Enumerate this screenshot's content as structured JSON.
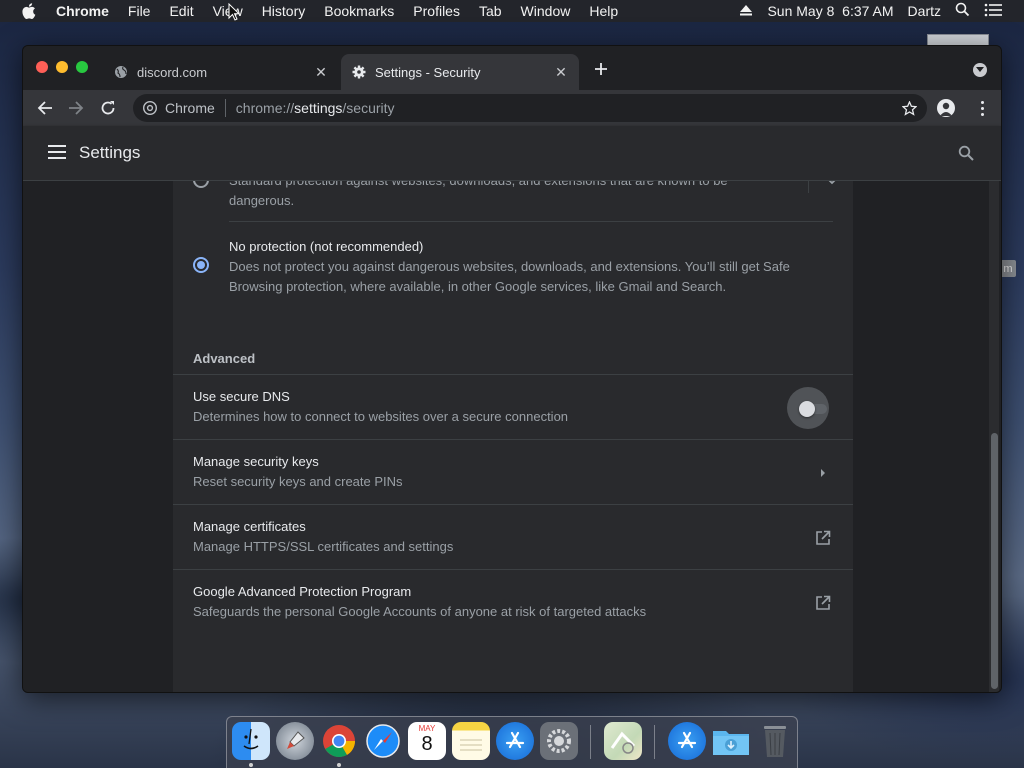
{
  "menubar": {
    "app": "Chrome",
    "items": [
      "File",
      "Edit",
      "View",
      "History",
      "Bookmarks",
      "Profiles",
      "Tab",
      "Window",
      "Help"
    ],
    "datetime": "Sun May 8  6:37 AM",
    "user": "Dartz"
  },
  "tabs": [
    {
      "title": "discord.com",
      "icon": "globe-icon"
    },
    {
      "title": "Settings - Security",
      "icon": "gear-icon"
    }
  ],
  "omnibox": {
    "chip": "Chrome",
    "url_prefix": "chrome://",
    "url_host": "settings",
    "url_path": "/security"
  },
  "settings": {
    "title": "Settings",
    "standard_protection_desc": "Standard protection against websites, downloads, and extensions that are known to be dangerous.",
    "no_protection_title": "No protection (not recommended)",
    "no_protection_desc": "Does not protect you against dangerous websites, downloads, and extensions. You’ll still get Safe Browsing protection, where available, in other Google services, like Gmail and Search.",
    "advanced_label": "Advanced",
    "rows": [
      {
        "title": "Use secure DNS",
        "subtitle": "Determines how to connect to websites over a secure connection",
        "control": "toggle",
        "enabled": false
      },
      {
        "title": "Manage security keys",
        "subtitle": "Reset security keys and create PINs",
        "control": "chevron-right-icon"
      },
      {
        "title": "Manage certificates",
        "subtitle": "Manage HTTPS/SSL certificates and settings",
        "control": "open-in-new-icon"
      },
      {
        "title": "Google Advanced Protection Program",
        "subtitle": "Safeguards the personal Google Accounts of anyone at risk of targeted attacks",
        "control": "open-in-new-icon"
      }
    ]
  },
  "desktop": {
    "badge": "m"
  },
  "dock": {
    "items": [
      "finder-icon",
      "launchpad-icon",
      "chrome-icon",
      "safari-icon",
      "calendar-icon",
      "notes-icon",
      "app-store-icon",
      "system-preferences-icon",
      "maps-icon",
      "app-store-folder-icon",
      "downloads-folder-icon",
      "trash-icon"
    ],
    "calendar_month": "MAY",
    "calendar_day": "8"
  },
  "colors": {
    "accent": "#8ab4f8",
    "window_bg": "#202124",
    "card_bg": "#292a2d",
    "toolbar_bg": "#35363a"
  }
}
